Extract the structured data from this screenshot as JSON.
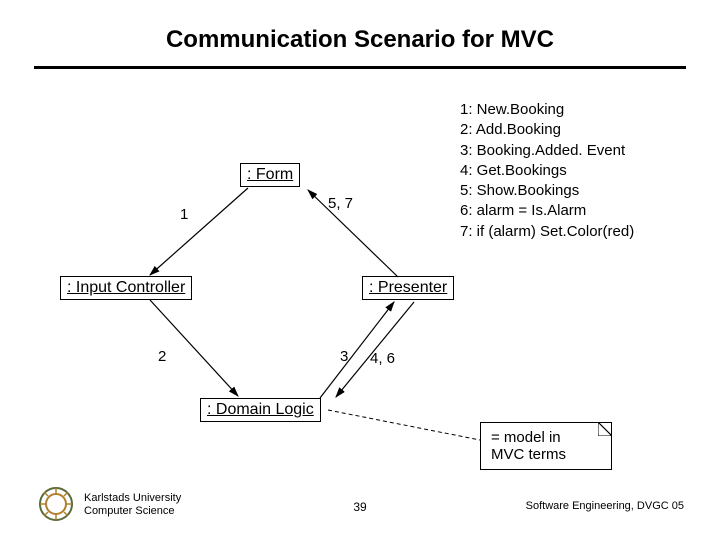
{
  "title": "Communication Scenario for MVC",
  "boxes": {
    "form": ": Form",
    "input_controller": ": Input Controller",
    "presenter": ": Presenter",
    "domain_logic": ": Domain Logic"
  },
  "edge_labels": {
    "e1": "1",
    "e57": "5, 7",
    "e2": "2",
    "e3": "3",
    "e46": "4, 6"
  },
  "legend": [
    "1: New.Booking",
    "2: Add.Booking",
    "3: Booking.Added. Event",
    "4: Get.Bookings",
    "5: Show.Bookings",
    "6: alarm = Is.Alarm",
    "7: if (alarm) Set.Color(red)"
  ],
  "note": {
    "line1": "= model in",
    "line2": "MVC terms"
  },
  "footer": {
    "uni1": "Karlstads University",
    "uni2": "Computer Science",
    "page": "39",
    "course": "Software Engineering, DVGC 05"
  }
}
